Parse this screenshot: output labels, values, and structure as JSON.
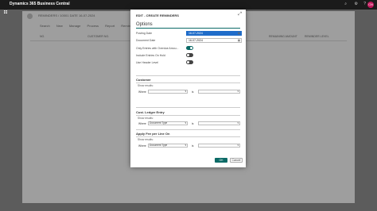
{
  "app": {
    "title": "Dynamics 365 Business Central",
    "avatar": "CN"
  },
  "background": {
    "page_title": "REMINDERS / 10001 DATE 16-07-2024",
    "actions": [
      "Search",
      "New",
      "Manage",
      "Process",
      "Report",
      "Reminder"
    ],
    "col_no": "NO.",
    "col_customer": "CUSTOMER NO.",
    "col_remaining": "REMAINING AMOUNT",
    "col_level": "REMINDER LEVEL"
  },
  "dialog": {
    "title": "EDIT - CREATE REMINDERS",
    "tab": "Options",
    "fields": [
      {
        "label": "Posting Date",
        "value": "16-07-2024",
        "type": "date",
        "selected": true
      },
      {
        "label": "Document Date",
        "value": "16-07-2024",
        "type": "date",
        "selected": false
      },
      {
        "label": "Only Entries with Overdue Amou...",
        "type": "toggle",
        "on": true
      },
      {
        "label": "Include Entries On Hold",
        "type": "toggle",
        "on": false
      },
      {
        "label": "Use Header Level",
        "type": "toggle",
        "on": false
      }
    ],
    "sections": [
      {
        "title": "Customer",
        "show_results": "Show results:",
        "where": "Where",
        "field": "",
        "is_label": "is",
        "value": ""
      },
      {
        "title": "Cust. Ledger Entry",
        "show_results": "Show results:",
        "where": "Where",
        "field": "Document Type",
        "is_label": "is",
        "value": ""
      },
      {
        "title": "Apply Fee per Line On",
        "show_results": "Show results:",
        "where": "Where",
        "field": "Document Type",
        "is_label": "is",
        "value": ""
      }
    ],
    "ok_label": "OK",
    "cancel_label": "Cancel"
  }
}
